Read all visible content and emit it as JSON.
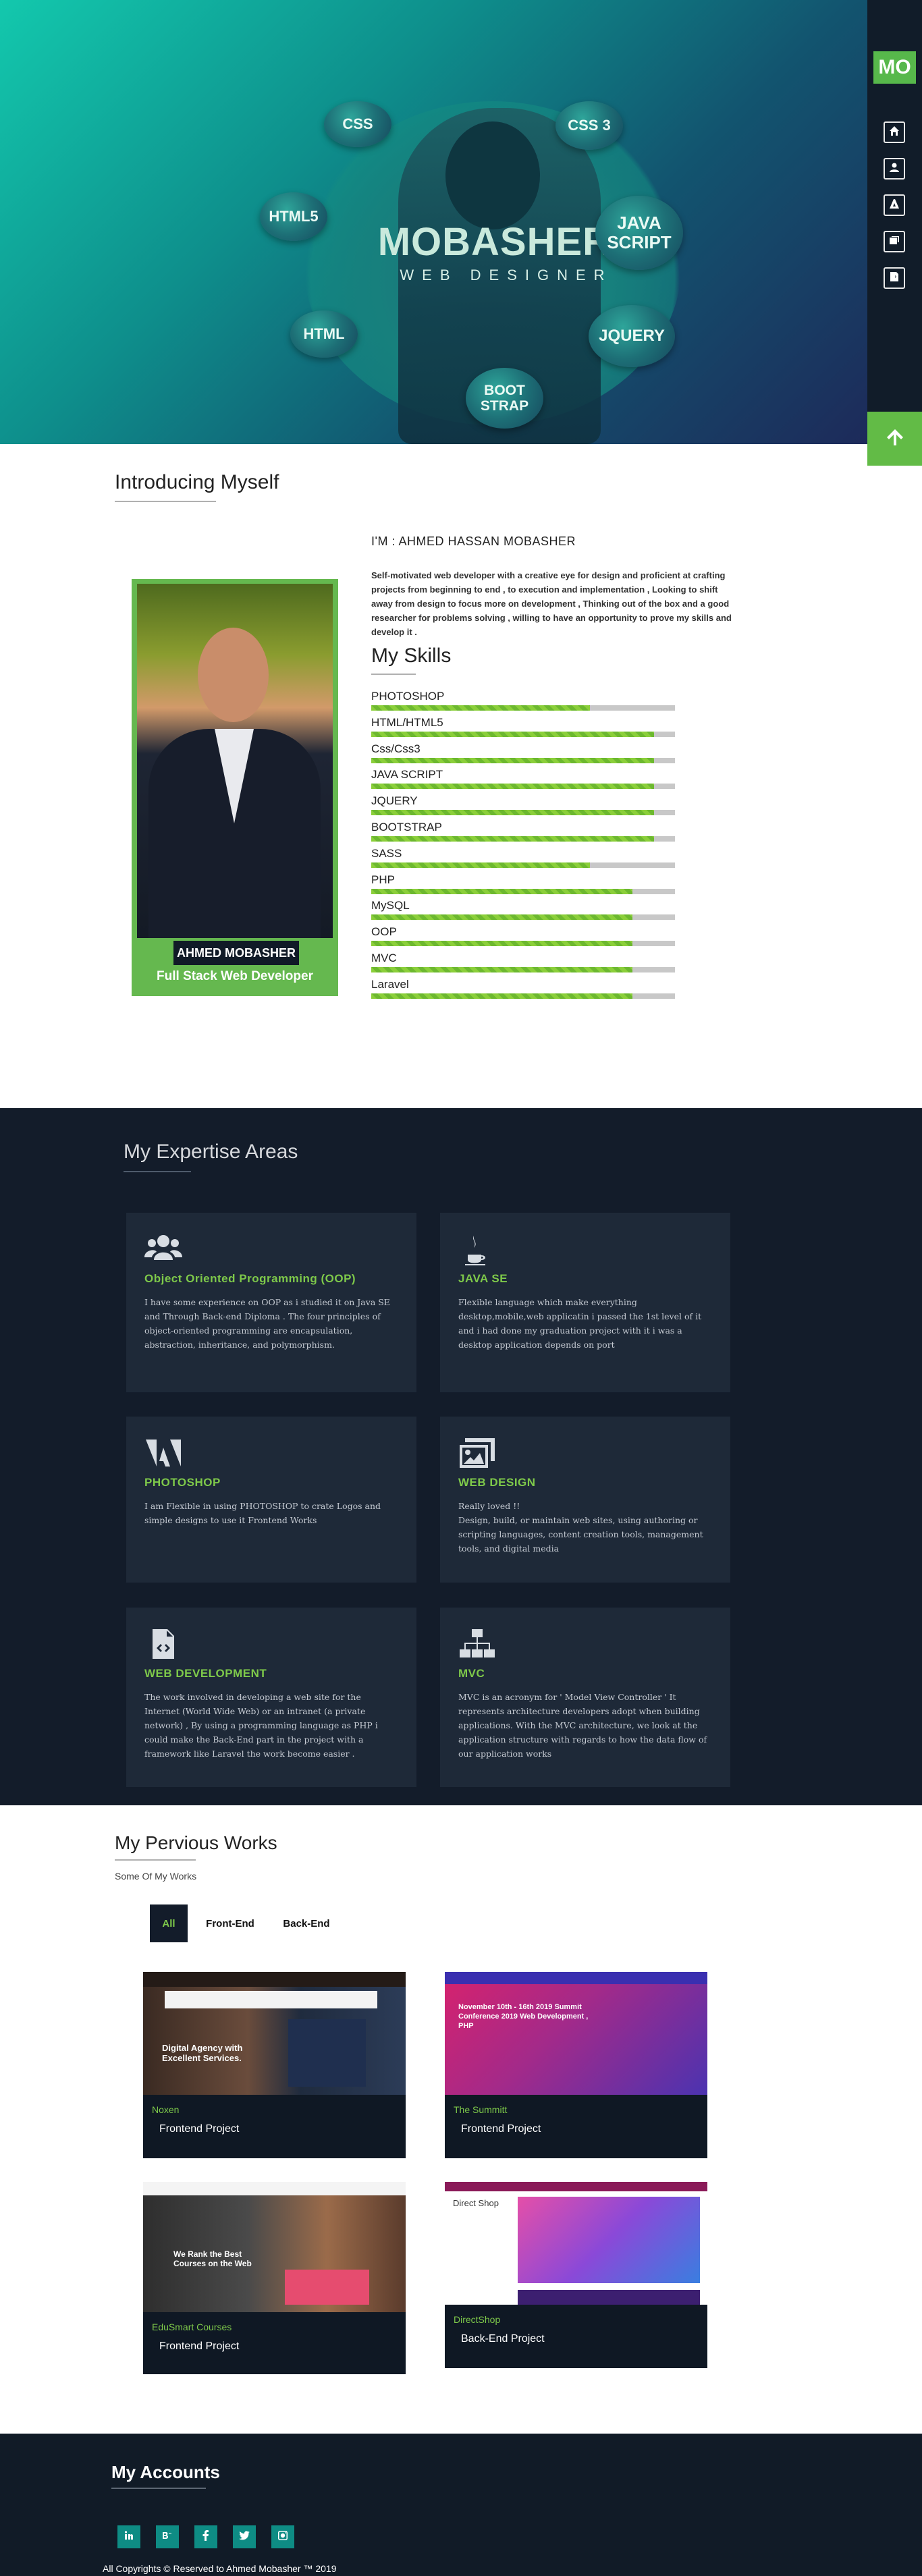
{
  "hero": {
    "name": "MOBASHER .",
    "subtitle": "WEB DESIGNER",
    "bubbles": [
      "CSS",
      "CSS 3",
      "HTML5",
      "JAVA SCRIPT",
      "HTML",
      "JQUERY",
      "BOOT STRAP"
    ]
  },
  "nav": {
    "logo": "MO",
    "icons": [
      "home-icon",
      "user-icon",
      "adobe-icon",
      "images-icon",
      "code-icon"
    ]
  },
  "about": {
    "section_title": "Introducing Myself",
    "name_tag": "AHMED MOBASHER",
    "role": "Full Stack Web Developer",
    "iam": "I'M : AHMED HASSAN MOBASHER",
    "description": "Self-motivated web developer with a creative eye for design and proficient at crafting projects from beginning to end , to execution and implementation , Looking to shift away from design to focus more on development , Thinking out of the box and a good researcher for problems solving , willing to have an opportunity to prove my skills and develop it .",
    "skills_title": "My Skills",
    "skills": [
      {
        "label": "PHOTOSHOP",
        "level": 0.72
      },
      {
        "label": "HTML/HTML5",
        "level": 0.93
      },
      {
        "label": "Css/Css3",
        "level": 0.93
      },
      {
        "label": "JAVA SCRIPT",
        "level": 0.93
      },
      {
        "label": "JQUERY",
        "level": 0.93
      },
      {
        "label": "BOOTSTRAP",
        "level": 0.93
      },
      {
        "label": "SASS",
        "level": 0.72
      },
      {
        "label": "PHP",
        "level": 0.86
      },
      {
        "label": "MySQL",
        "level": 0.86
      },
      {
        "label": "OOP",
        "level": 0.86
      },
      {
        "label": "MVC",
        "level": 0.86
      },
      {
        "label": "Laravel",
        "level": 0.86
      }
    ]
  },
  "expertise": {
    "title": "My Expertise Areas",
    "cards": [
      {
        "icon": "users-icon",
        "title": "Object Oriented Programming (OOP)",
        "text": "I have some experience on OOP as i studied it on Java SE and Through Back-end Diploma . The four principles of object-oriented programming are encapsulation, abstraction, inheritance, and polymorphism."
      },
      {
        "icon": "java-icon",
        "title": "JAVA SE",
        "text": "Flexible language which make everything desktop,mobile,web applicatin i passed the 1st level of it and i had done my graduation project with it i was a desktop application depends on port"
      },
      {
        "icon": "adobe-icon",
        "title": "PHOTOSHOP",
        "text": "I am Flexible in using PHOTOSHOP to crate Logos and simple designs to use it Frontend Works"
      },
      {
        "icon": "images-icon",
        "title": "WEB DESIGN",
        "text": "Really loved !!\nDesign, build, or maintain web sites, using authoring or scripting languages, content creation tools, management tools, and digital media"
      },
      {
        "icon": "code-file-icon",
        "title": "WEB DEVELOPMENT",
        "text": "The work involved in developing a web site for the Internet (World Wide Web) or an intranet (a private network) , By using a programming language as PHP i could make the Back-End part in the project with a framework like Laravel the work become easier ."
      },
      {
        "icon": "sitemap-icon",
        "title": "MVC",
        "text": "MVC is an acronym for ' Model View Controller ' It represents architecture developers adopt when building applications. With the MVC architecture, we look at the application structure with regards to how the data flow of our application works"
      }
    ]
  },
  "works": {
    "title": "My Pervious Works",
    "subtitle": "Some Of My Works",
    "filters": [
      "All",
      "Front-End",
      "Back-End"
    ],
    "items": [
      {
        "category": "Noxen",
        "type": "Frontend Project",
        "shot_text": "Digital Agency with Excellent Services."
      },
      {
        "category": "The Summitt",
        "type": "Frontend Project",
        "shot_text": "November 10th - 16th 2019 Summit Conference 2019 Web Development , PHP"
      },
      {
        "category": "EduSmart Courses",
        "type": "Frontend Project",
        "shot_text": "We Rank the Best Courses on the Web"
      },
      {
        "category": "DirectShop",
        "type": "Back-End Project",
        "shot_text": "Direct Shop"
      }
    ]
  },
  "footer": {
    "title": "My Accounts",
    "socials": [
      "linkedin-icon",
      "behance-icon",
      "facebook-icon",
      "twitter-icon",
      "instagram-icon"
    ],
    "copyright": "All Copyrights © Reserved to Ahmed Mobasher ™ 2019"
  }
}
